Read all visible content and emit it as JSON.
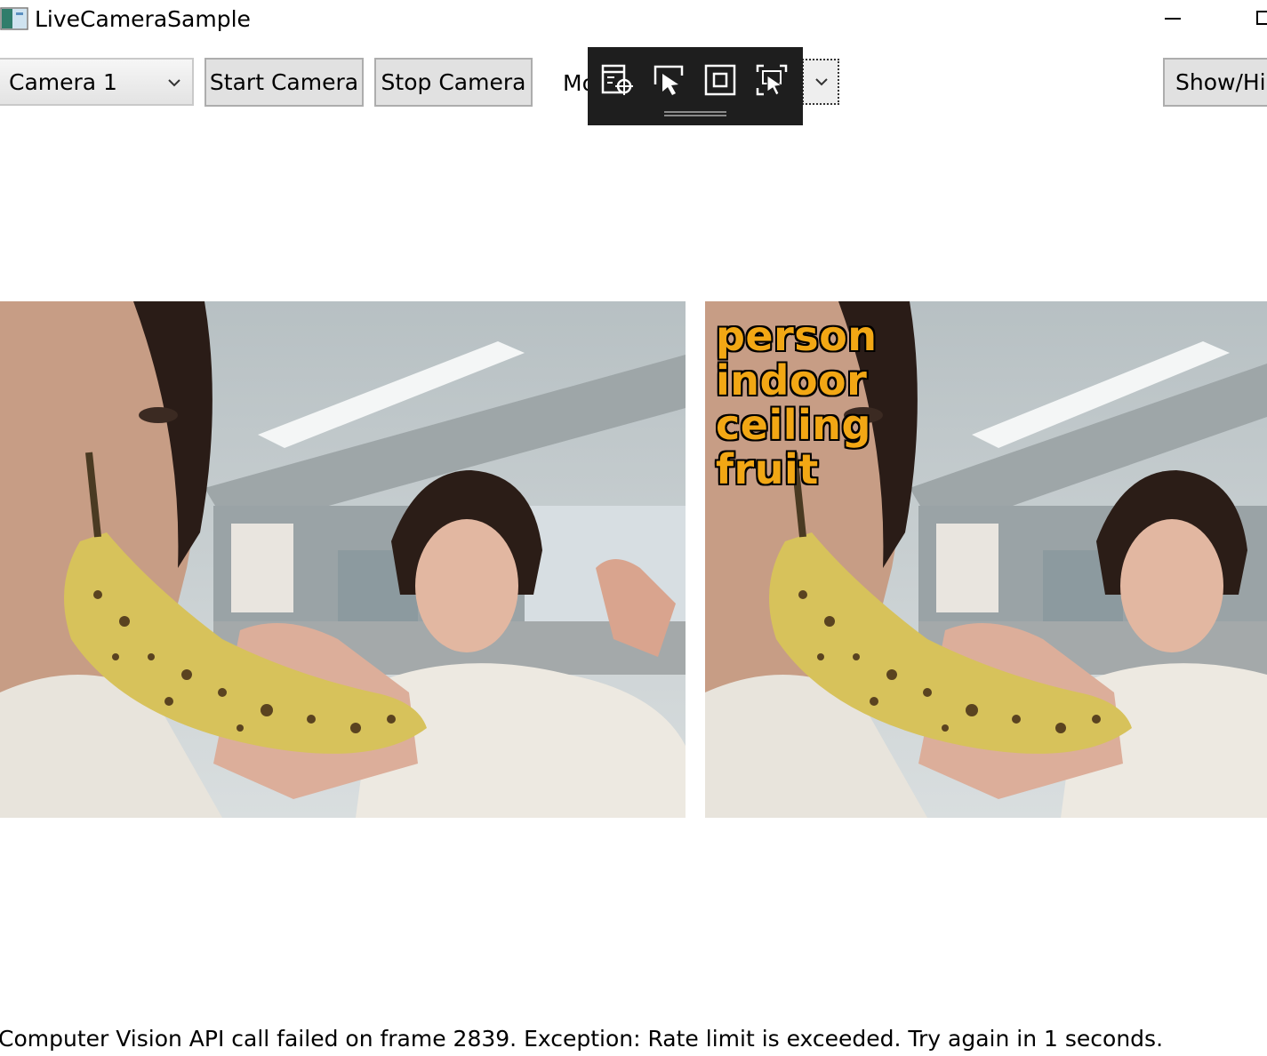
{
  "window": {
    "title": "LiveCameraSample",
    "icon": "app-window-icon",
    "controls": [
      "minimize-icon",
      "maximize-icon"
    ]
  },
  "toolbar": {
    "camera_select": {
      "selected": "Camera 1",
      "icon": "chevron-down-icon"
    },
    "start_label": "Start Camera",
    "stop_label": "Stop Camera",
    "mode_label": "Mo",
    "show_hide_label": "Show/Hid"
  },
  "debug_toolbar": {
    "icons": [
      "live-visual-tree-icon",
      "select-element-icon",
      "display-layout-adorners-icon",
      "track-focused-element-icon"
    ]
  },
  "frames": {
    "left": {
      "description_icon": "camera-frame-image"
    },
    "right": {
      "tags": [
        "person",
        "indoor",
        "ceiling",
        "fruit"
      ],
      "tag_color": "#f2a714"
    }
  },
  "status": {
    "message": "Computer Vision API call failed on frame 2839. Exception: Rate limit is exceeded. Try again in 1 seconds."
  }
}
